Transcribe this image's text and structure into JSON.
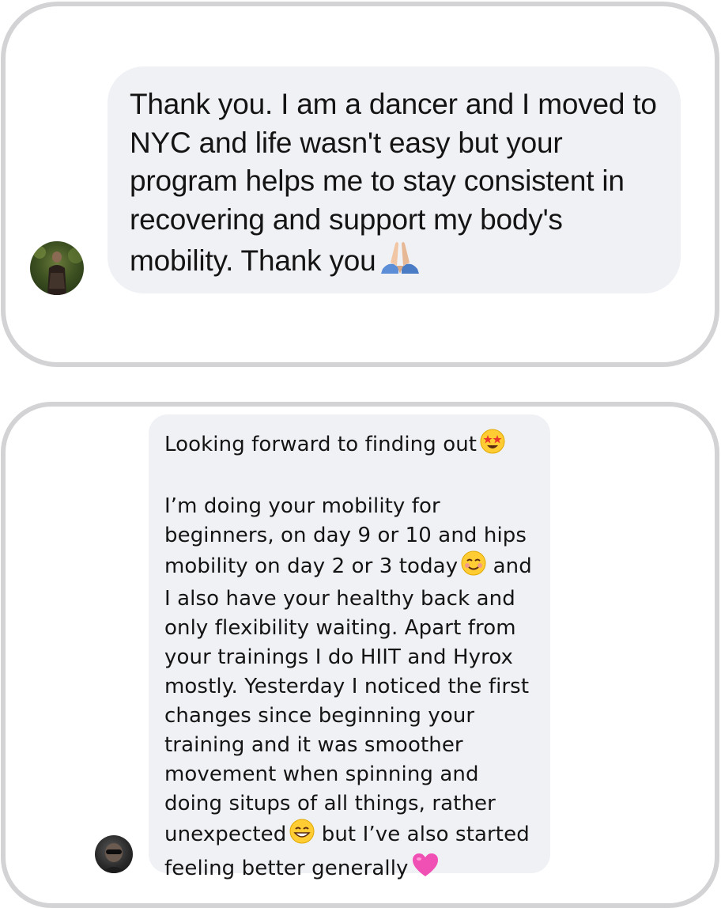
{
  "messages": [
    {
      "text": "Thank you. I am a dancer and I moved to NYC and life wasn't easy but your program helps me to stay consistent in recovering and support my body's mobility. Thank you",
      "emoji_end": "praying-hands"
    },
    {
      "line_1": "Looking forward to finding out",
      "line_1_emoji": "star-struck",
      "paragraph_2": "I’m doing your mobility for beginners, on day 9 or 10 and hips mobility on day 2 or 3 today",
      "paragraph_2_emoji": "smiling-face",
      "paragraph_2_cont": "and I also have your healthy back and only flexibility waiting. Apart from your trainings I do HIIT and Hyrox mostly. Yesterday I noticed the first changes since beginning your training and it was smoother movement when spinning and doing situps of all things, rather unexpected",
      "paragraph_2_emoji_2": "grinning-face",
      "paragraph_2_end": "but I’ve also started feeling better generally",
      "paragraph_2_emoji_3": "pink-heart"
    }
  ],
  "colors": {
    "bubble_bg": "#f0f1f5",
    "card_border": "#d3d3d5",
    "text": "#141414"
  }
}
